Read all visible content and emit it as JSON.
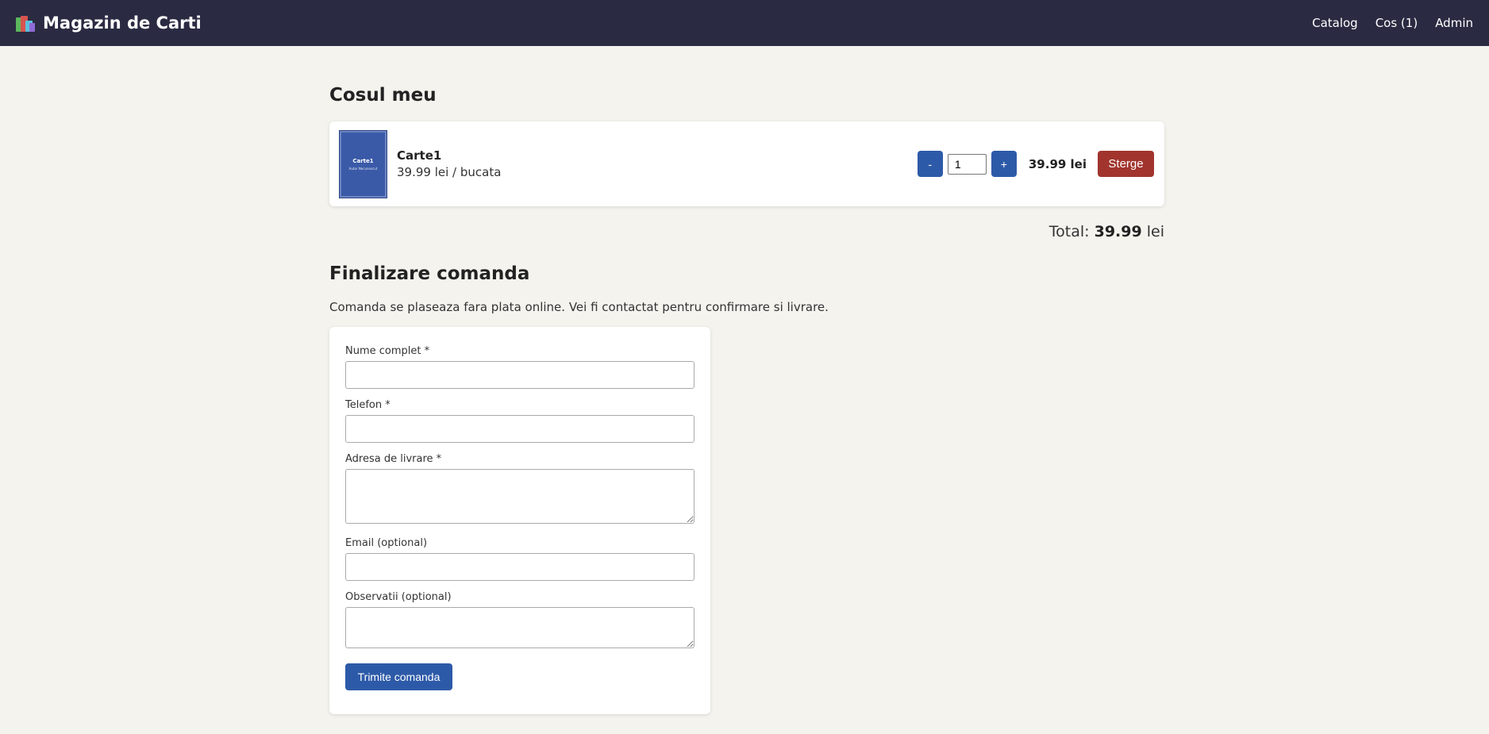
{
  "navbar": {
    "brand": "Magazin de Carti",
    "links": {
      "catalog": "Catalog",
      "cart": "Cos (1)",
      "admin": "Admin"
    }
  },
  "cart": {
    "title": "Cosul meu",
    "items": [
      {
        "cover_title": "Carte1",
        "cover_subtitle": "Autor Necunoscut",
        "title": "Carte1",
        "unit_price": "39.99 lei / bucata",
        "quantity": "1",
        "line_total": "39.99 lei",
        "decrease_label": "-",
        "increase_label": "+",
        "delete_label": "Sterge"
      }
    ],
    "total_label": "Total:",
    "total_value": "39.99",
    "total_currency": "lei"
  },
  "checkout": {
    "title": "Finalizare comanda",
    "notice": "Comanda se plaseaza fara plata online. Vei fi contactat pentru confirmare si livrare.",
    "fields": {
      "name_label": "Nume complet *",
      "phone_label": "Telefon *",
      "address_label": "Adresa de livrare *",
      "email_label": "Email (optional)",
      "notes_label": "Observatii (optional)"
    },
    "submit_label": "Trimite comanda"
  },
  "colors": {
    "navbar_bg": "#2a2b42",
    "primary": "#2d5aa8",
    "danger": "#a1352e",
    "page_bg": "#f4f3ee"
  }
}
